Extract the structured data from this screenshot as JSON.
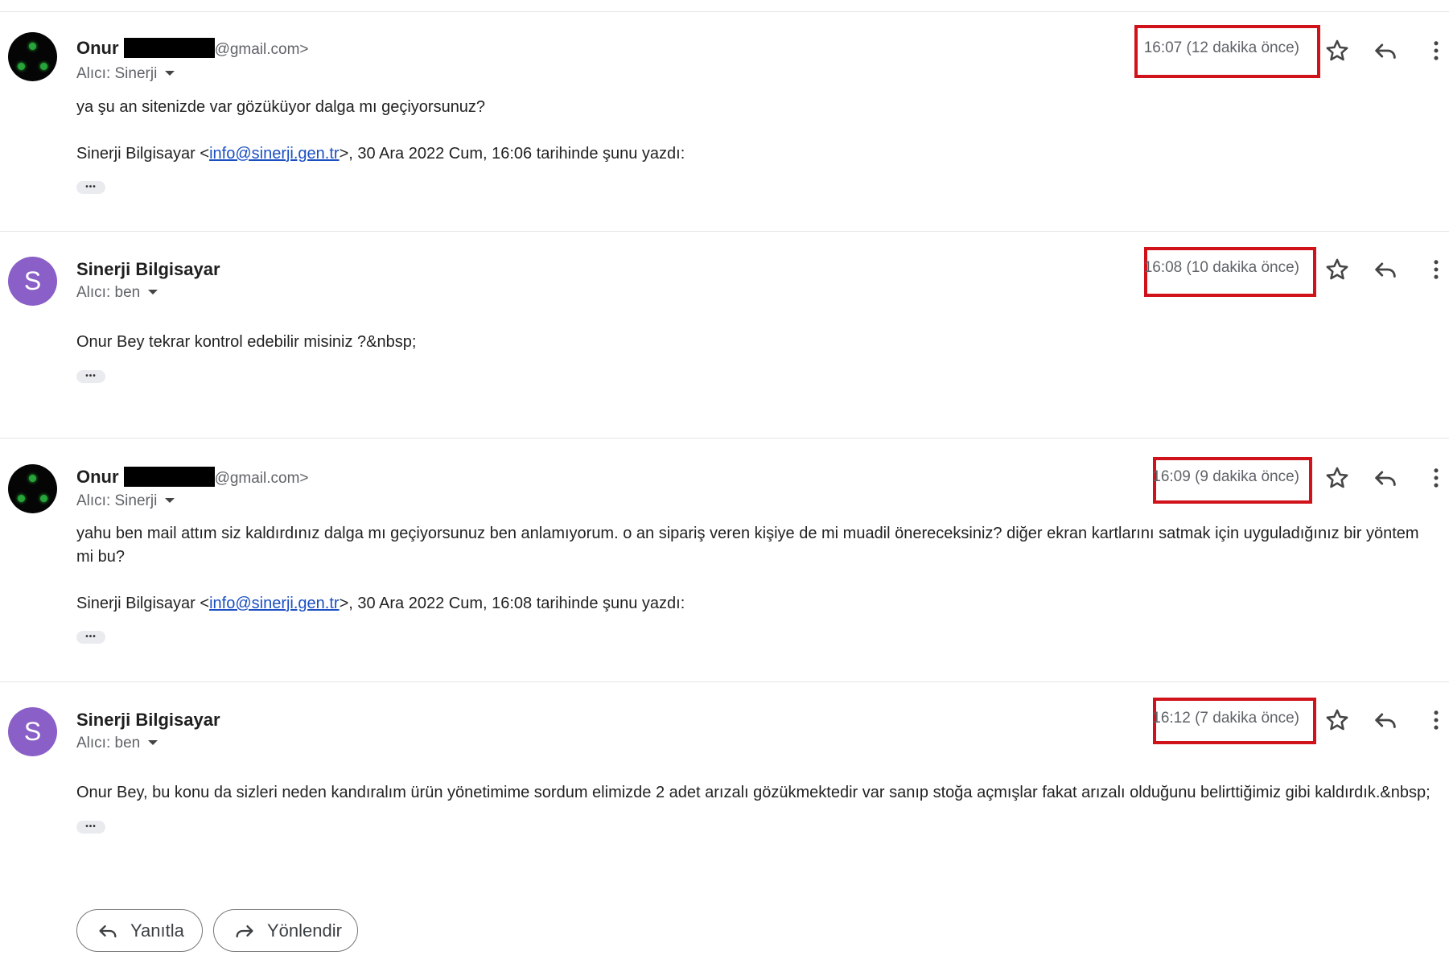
{
  "messages": [
    {
      "sender_name": "Onur",
      "sender_email_visible": "@gmail.com>",
      "recipient": "Alıcı: Sinerji",
      "time": "16:07 (12 dakika önce)",
      "body_lines": [
        "ya şu an sitenizde var gözüküyor dalga mı geçiyorsunuz?"
      ],
      "quote_prefix": "Sinerji Bilgisayar <",
      "quote_link": "info@sinerji.gen.tr",
      "quote_suffix": ">, 30 Ara 2022 Cum, 16:06 tarihinde şunu yazdı:"
    },
    {
      "sender_name": "Sinerji Bilgisayar",
      "avatar_letter": "S",
      "recipient": "Alıcı: ben",
      "time": "16:08 (10 dakika önce)",
      "body_lines": [
        "Onur Bey tekrar kontrol edebilir misiniz ?&nbsp;"
      ]
    },
    {
      "sender_name": "Onur",
      "sender_email_visible": "@gmail.com>",
      "recipient": "Alıcı: Sinerji",
      "time": "16:09 (9 dakika önce)",
      "body_lines": [
        "yahu ben mail attım siz kaldırdınız dalga mı geçiyorsunuz ben anlamıyorum. o an sipariş veren kişiye de mi muadil önereceksiniz? diğer ekran kartlarını satmak için uyguladığınız bir yöntem mi bu?"
      ],
      "quote_prefix": "Sinerji Bilgisayar <",
      "quote_link": "info@sinerji.gen.tr",
      "quote_suffix": ">, 30 Ara 2022 Cum, 16:08 tarihinde şunu yazdı:"
    },
    {
      "sender_name": "Sinerji Bilgisayar",
      "avatar_letter": "S",
      "recipient": "Alıcı: ben",
      "time": "16:12 (7 dakika önce)",
      "body_lines": [
        "Onur Bey, bu konu da sizleri neden kandıralım ürün yönetimime sordum elimizde 2 adet arızalı gözükmektedir var sanıp stoğa açmışlar fakat arızalı olduğunu belirttiğimiz gibi kaldırdık.&nbsp;"
      ]
    }
  ],
  "ellipsis": "•••",
  "actions": {
    "reply_label": "Yanıtla",
    "forward_label": "Yönlendir"
  },
  "colors": {
    "highlight_box": "#d0121b",
    "avatar_purple": "#8a5fc7",
    "link": "#1a4fc2"
  },
  "icons": [
    "star-icon",
    "reply-icon",
    "more-vert-icon",
    "forward-icon",
    "dropdown-caret-icon"
  ]
}
